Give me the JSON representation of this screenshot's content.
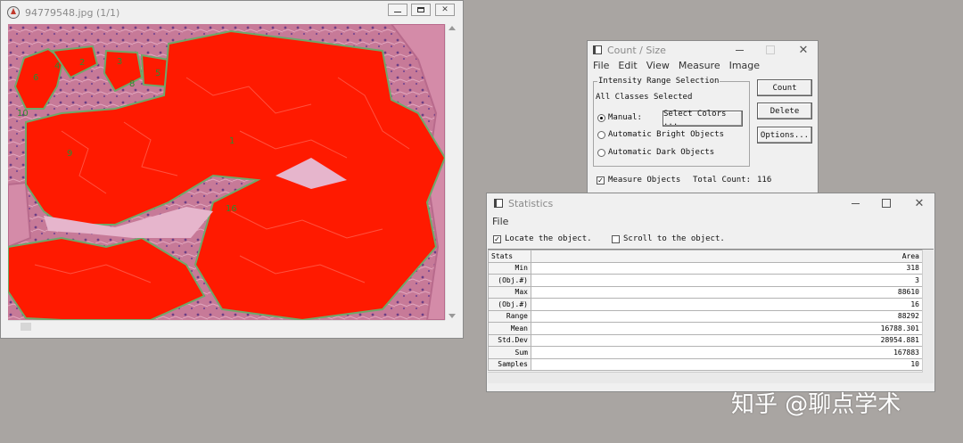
{
  "image_window": {
    "title": "94779548.jpg (1/1)",
    "object_labels": [
      "4",
      "2",
      "3",
      "5",
      "6",
      "8",
      "10",
      "1",
      "9",
      "16"
    ]
  },
  "count_window": {
    "title": "Count / Size",
    "menu": [
      "File",
      "Edit",
      "View",
      "Measure",
      "Image"
    ],
    "group_title": "Intensity Range Selection",
    "classes_text": "All Classes Selected",
    "manual_label": "Manual:",
    "select_colors_label": "Select Colors ...",
    "auto_bright_label": "Automatic Bright Objects",
    "auto_dark_label": "Automatic Dark Objects",
    "measure_label": "Measure Objects",
    "total_count_label": "Total Count:",
    "total_count_value": "116",
    "count_button": "Count",
    "delete_button": "Delete",
    "options_button": "Options..."
  },
  "stats_window": {
    "title": "Statistics",
    "menu": [
      "File"
    ],
    "locate_label": "Locate the object.",
    "scroll_label": "Scroll to the object.",
    "header": [
      "Stats",
      "Area"
    ],
    "rows": [
      [
        "Min",
        "318"
      ],
      [
        "(Obj.#)",
        "3"
      ],
      [
        "Max",
        "88610"
      ],
      [
        "(Obj.#)",
        "16"
      ],
      [
        "Range",
        "88292"
      ],
      [
        "Mean",
        "16788.301"
      ],
      [
        "Std.Dev",
        "28954.881"
      ],
      [
        "Sum",
        "167883"
      ],
      [
        "Samples",
        "10"
      ]
    ]
  },
  "watermark": "知乎 @聊点学术"
}
